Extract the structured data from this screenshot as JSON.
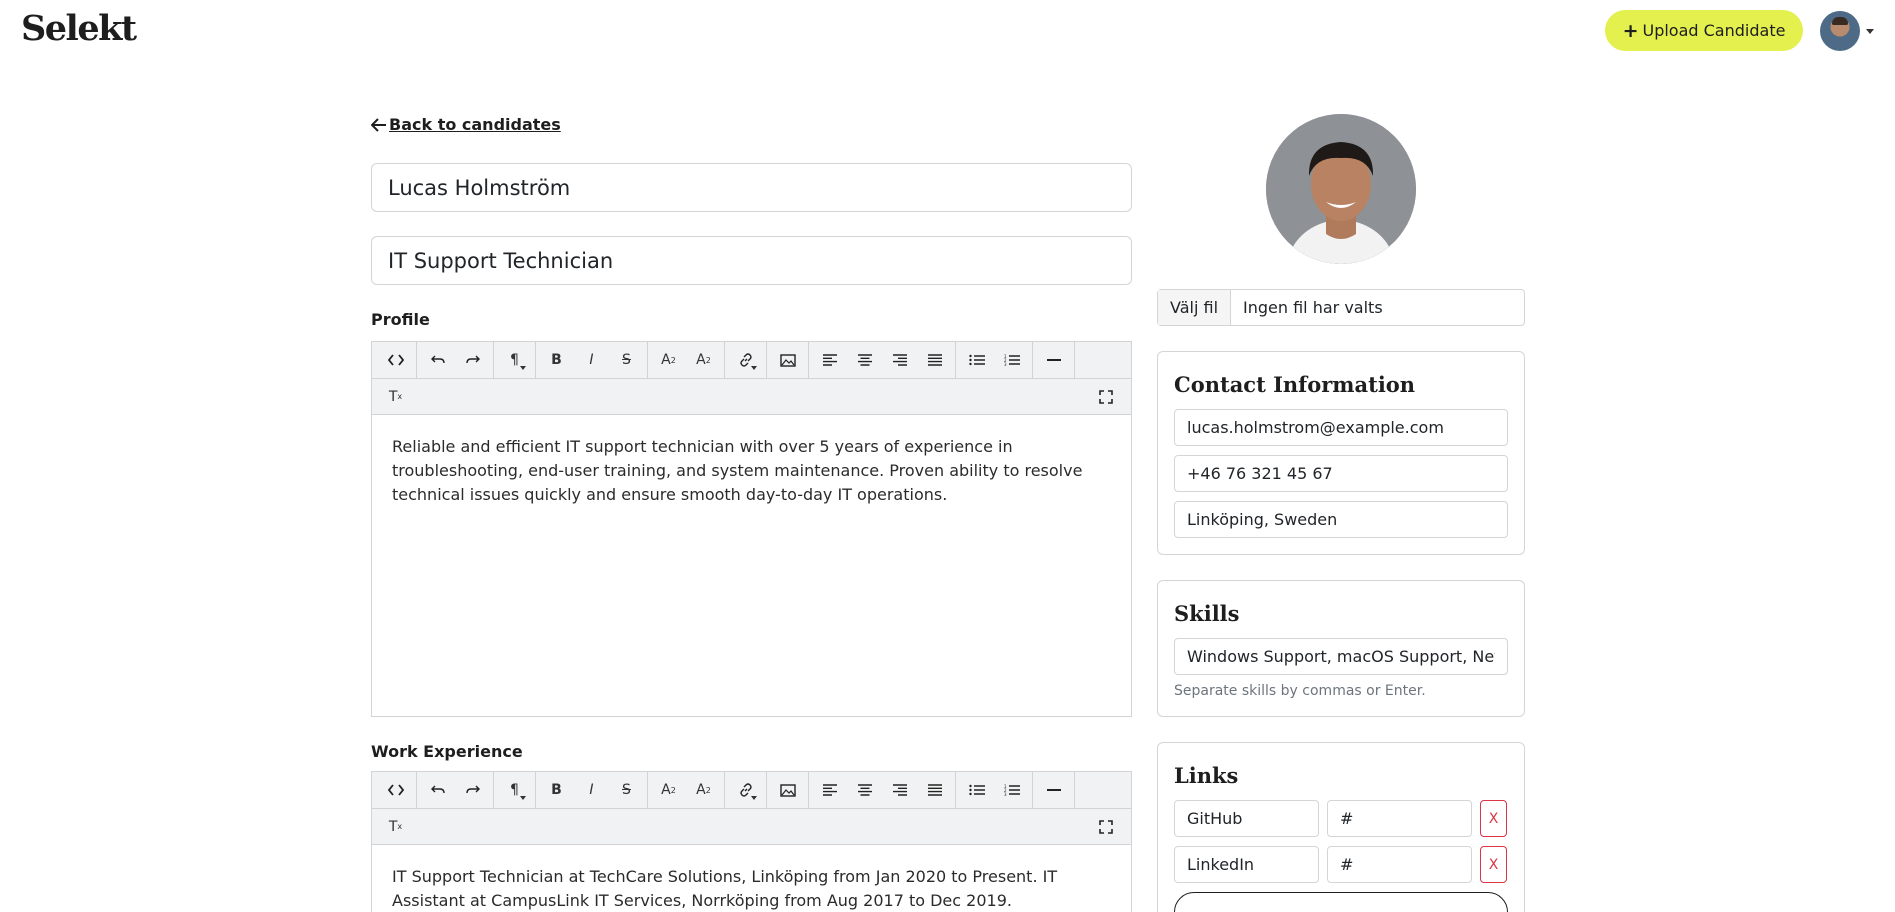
{
  "header": {
    "logo": "Selekt",
    "upload_label": "Upload Candidate",
    "upload_icon": "plus-icon"
  },
  "back_link": {
    "label": "Back to candidates",
    "icon": "arrow-left-icon"
  },
  "candidate": {
    "name": "Lucas Holmström",
    "title": "IT Support Technician"
  },
  "profile": {
    "label": "Profile",
    "text": "Reliable and efficient IT support technician with over 5 years of experience in troubleshooting, end-user training, and system maintenance. Proven ability to resolve technical issues quickly and ensure smooth day-to-day IT operations."
  },
  "work_experience": {
    "label": "Work Experience",
    "text": "IT Support Technician at TechCare Solutions, Linköping from Jan 2020 to Present. IT Assistant at CampusLink IT Services, Norrköping from Aug 2017 to Dec 2019."
  },
  "photo_upload": {
    "button_label": "Välj fil",
    "status": "Ingen fil har valts"
  },
  "contact": {
    "title": "Contact Information",
    "email": "lucas.holmstrom@example.com",
    "phone": "+46 76 321 45 67",
    "location": "Linköping, Sweden"
  },
  "skills": {
    "title": "Skills",
    "value": "Windows Support, macOS Support, Network Troubleshooting",
    "help": "Separate skills by commas or Enter."
  },
  "links": {
    "title": "Links",
    "items": [
      {
        "name": "GitHub",
        "url": "#",
        "remove_label": "X"
      },
      {
        "name": "LinkedIn",
        "url": "#",
        "remove_label": "X"
      }
    ]
  },
  "colors": {
    "accent": "#e4f04e",
    "danger": "#dc3545",
    "border": "#d5d5d5",
    "toolbar_bg": "#f1f2f3"
  }
}
